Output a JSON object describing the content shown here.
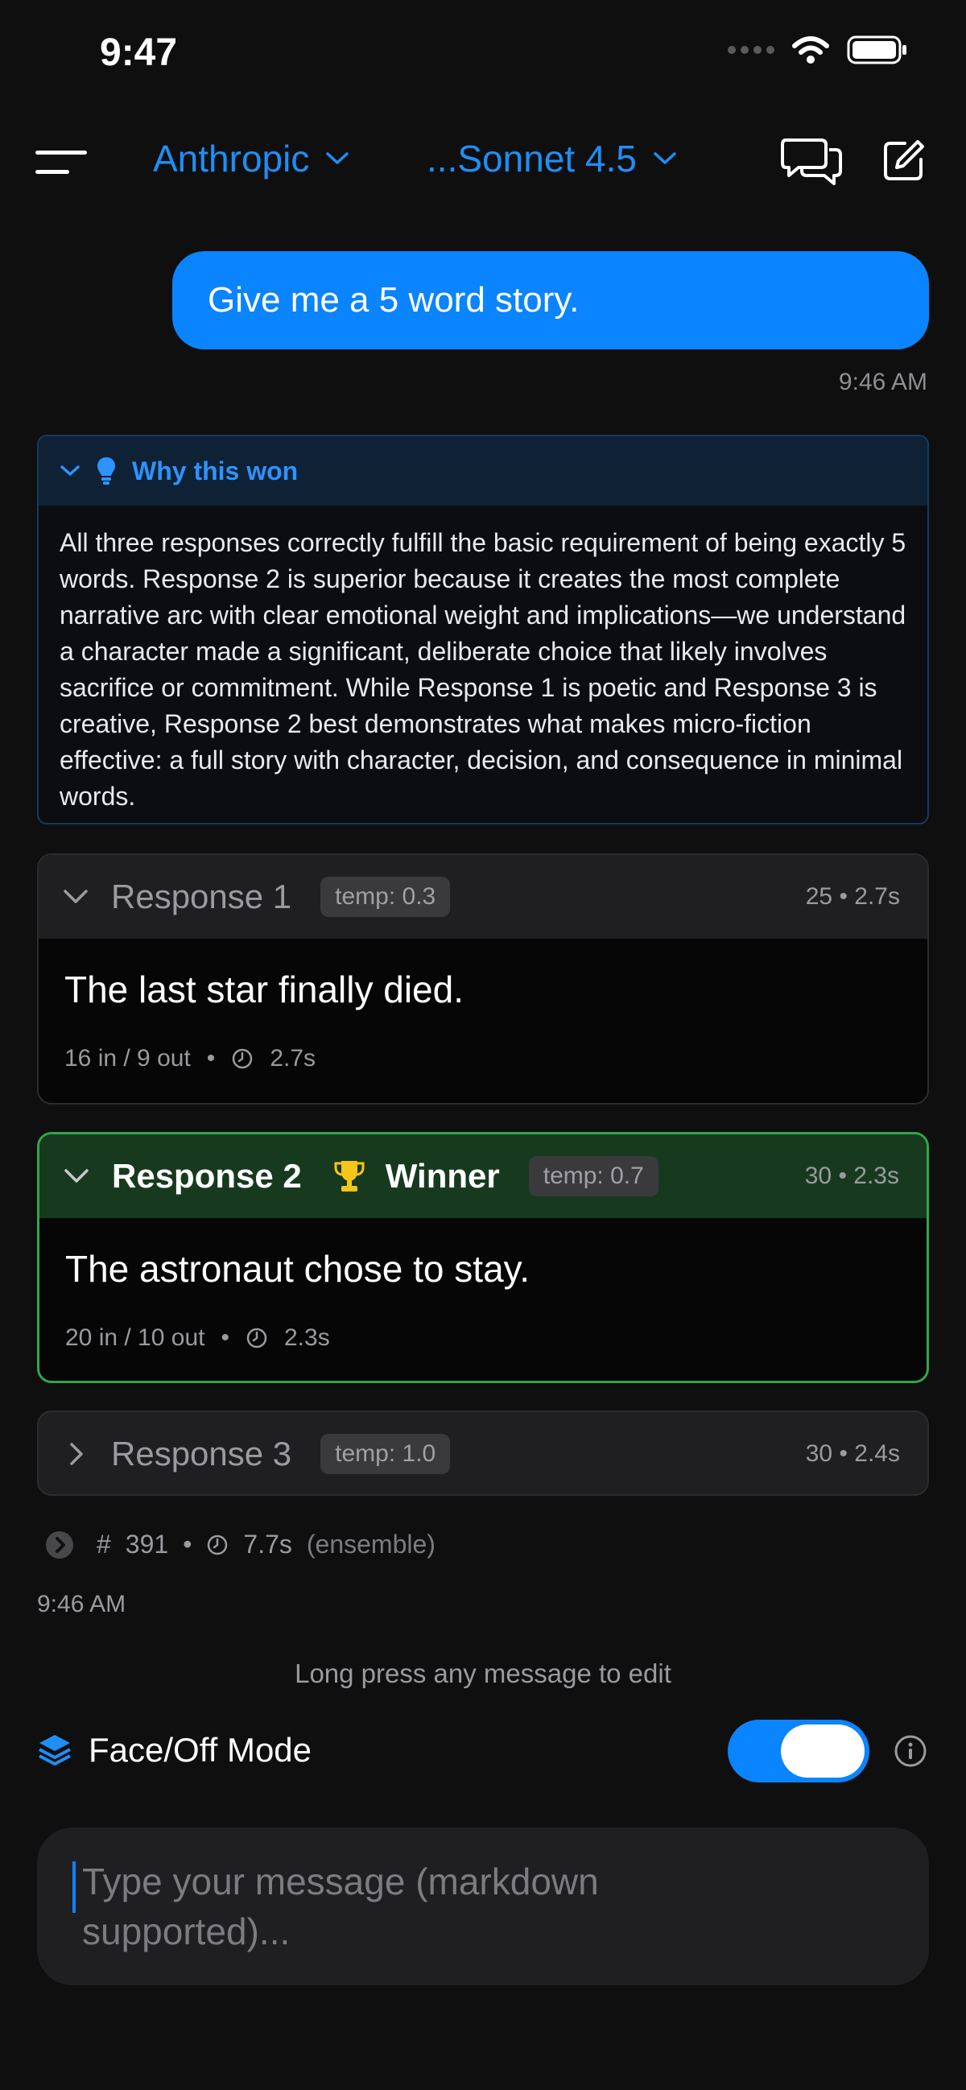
{
  "status_bar": {
    "time": "9:47"
  },
  "nav": {
    "provider": "Anthropic",
    "model": "...Sonnet 4.5"
  },
  "user_message": {
    "text": "Give me a 5 word story.",
    "time": "9:46 AM"
  },
  "why_won": {
    "title": "Why this won",
    "body": "All three responses correctly fulfill the basic requirement of being exactly 5 words. Response 2 is superior because it creates the most complete narrative arc with clear emotional weight and implications—we understand a character made a significant, deliberate choice that likely involves sacrifice or commitment. While Response 1 is poetic and Response 3 is creative, Response 2 best demonstrates what makes micro-fiction effective: a full story with character, decision, and consequence in minimal words."
  },
  "responses": [
    {
      "title": "Response 1",
      "temp": "temp: 0.3",
      "stats": "25 • 2.7s",
      "text": "The last star finally died.",
      "tokens": "16 in / 9 out",
      "duration": "2.7s"
    },
    {
      "title": "Response 2",
      "winner_label": "Winner",
      "temp": "temp: 0.7",
      "stats": "30 • 2.3s",
      "text": "The astronaut chose to stay.",
      "tokens": "20 in / 10 out",
      "duration": "2.3s"
    },
    {
      "title": "Response 3",
      "temp": "temp: 1.0",
      "stats": "30 • 2.4s"
    }
  ],
  "meta": {
    "hash": "#",
    "count": "391",
    "total_time": "7.7s",
    "mode": "(ensemble)",
    "time": "9:46 AM"
  },
  "hint": "Long press any message to edit",
  "faceoff": {
    "label": "Face/Off Mode",
    "enabled": true
  },
  "composer": {
    "placeholder": "Type your message (markdown supported)..."
  },
  "colors": {
    "accent": "#0a84ff",
    "winner_border": "#2ea84a",
    "winner_bg": "#173a1e",
    "why_head_bg": "#0f2134"
  },
  "icons": [
    "menu-icon",
    "chevron-down-icon",
    "chat-bubbles-icon",
    "compose-icon",
    "lightbulb-icon",
    "trophy-icon",
    "clock-icon",
    "chevron-right-icon",
    "layers-icon",
    "info-icon"
  ]
}
